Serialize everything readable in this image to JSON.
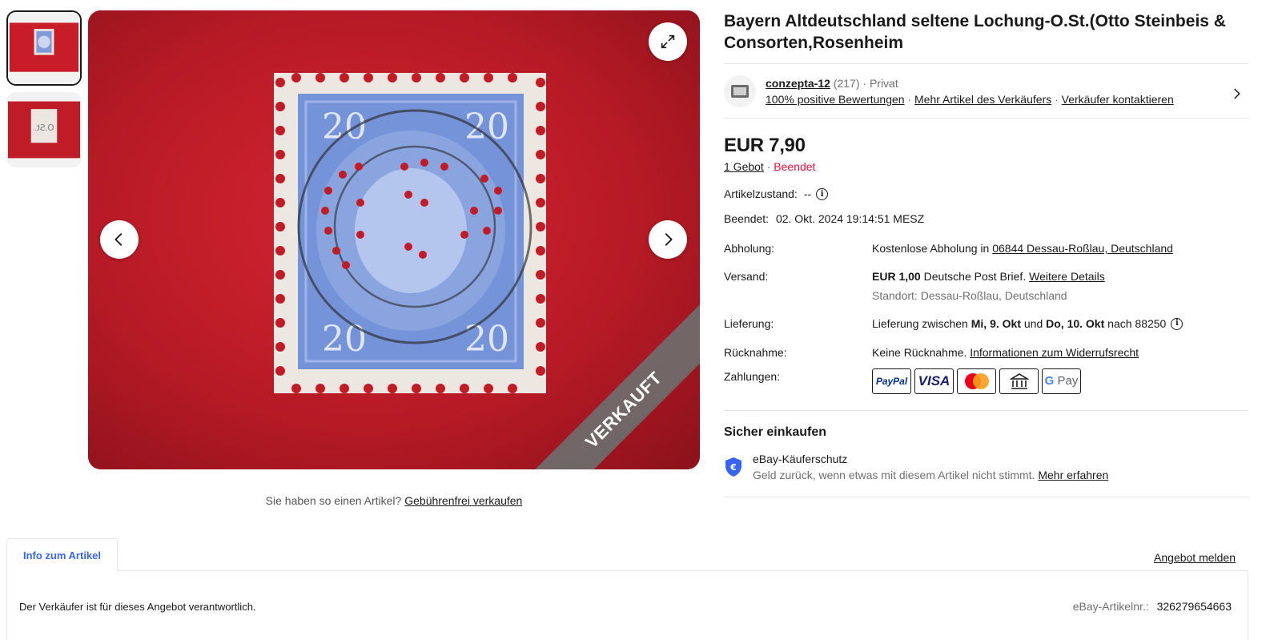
{
  "title": "Bayern Altdeutschland seltene Lochung-O.St.(Otto Steinbeis & Consorten,Rosenheim",
  "gallery": {
    "sold_ribbon": "VERKAUFT",
    "sell_similar_text": "Sie haben so einen Artikel?",
    "sell_similar_link": "Gebührenfrei verkaufen"
  },
  "seller": {
    "name": "conzepta-12",
    "rating_count": "(217)",
    "type": "· Privat",
    "feedback": "100% positive Bewertungen",
    "more_items": "Mehr Artikel des Verkäufers",
    "contact": "Verkäufer kontaktieren"
  },
  "price": "EUR 7,90",
  "bids_link": "1 Gebot",
  "status": "Beendet",
  "condition_label": "Artikelzustand:",
  "condition_value": "--",
  "ended_label": "Beendet:",
  "ended_value": "02. Okt. 2024 19:14:51 MESZ",
  "pickup": {
    "label": "Abholung:",
    "text": "Kostenlose Abholung in",
    "link": "06844 Dessau-Roßlau, Deutschland"
  },
  "shipping": {
    "label": "Versand:",
    "cost": "EUR 1,00",
    "method": "Deutsche Post Brief.",
    "details_link": "Weitere Details",
    "location": "Standort: Dessau-Roßlau, Deutschland"
  },
  "delivery": {
    "label": "Lieferung:",
    "prefix": "Lieferung zwischen",
    "from": "Mi, 9. Okt",
    "and": "und",
    "to": "Do, 10. Okt",
    "suffix": "nach 88250"
  },
  "returns": {
    "label": "Rücknahme:",
    "text": "Keine Rücknahme.",
    "link": "Informationen zum Widerrufsrecht"
  },
  "payments": {
    "label": "Zahlungen:",
    "methods": [
      "PayPal",
      "VISA",
      "Mastercard",
      "Bank",
      "G Pay"
    ]
  },
  "safe_shopping": {
    "title": "Sicher einkaufen",
    "protection_title": "eBay-Käuferschutz",
    "protection_text": "Geld zurück, wenn etwas mit diesem Artikel nicht stimmt.",
    "learn_more": "Mehr erfahren"
  },
  "tabs": {
    "active": "Info zum Artikel",
    "report": "Angebot melden"
  },
  "panel": {
    "responsibility": "Der Verkäufer ist für dieses Angebot verantwortlich.",
    "item_number_label": "eBay-Artikelnr.:",
    "item_number": "326279654663"
  },
  "colors": {
    "link_blue": "#3665f3",
    "ended_red": "#e0103a",
    "felt_red": "#c21b26",
    "stamp_blue": "#6f8fd6"
  }
}
